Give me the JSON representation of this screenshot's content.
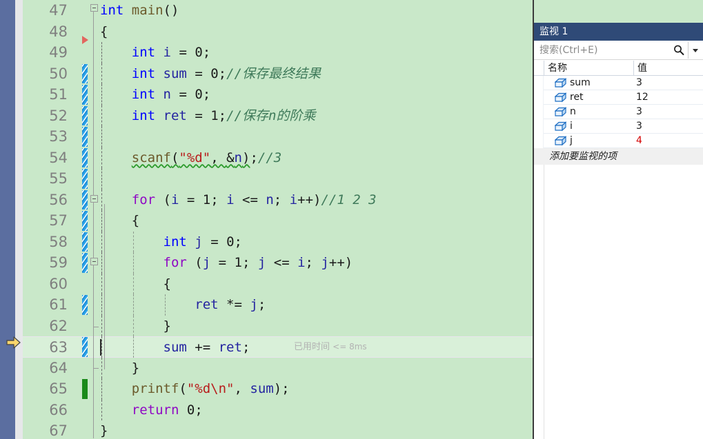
{
  "editor": {
    "background_color": "#c9e8c9",
    "current_line_number": 63,
    "lines": [
      {
        "no": "47",
        "segments": [
          {
            "t": "int",
            "c": "kw"
          },
          {
            "t": " ",
            "c": "punc"
          },
          {
            "t": "main",
            "c": "fn"
          },
          {
            "t": "()",
            "c": "punc"
          }
        ],
        "indent": 0,
        "changebar": "none"
      },
      {
        "no": "48",
        "segments": [
          {
            "t": "{",
            "c": "punc"
          }
        ],
        "indent": 0,
        "changebar": "none"
      },
      {
        "no": "49",
        "segments": [
          {
            "t": "    ",
            "c": "punc"
          },
          {
            "t": "int",
            "c": "kw"
          },
          {
            "t": " ",
            "c": "punc"
          },
          {
            "t": "i",
            "c": "id"
          },
          {
            "t": " = ",
            "c": "punc"
          },
          {
            "t": "0",
            "c": "num"
          },
          {
            "t": ";",
            "c": "punc"
          }
        ],
        "indent": 1,
        "changebar": "none"
      },
      {
        "no": "50",
        "segments": [
          {
            "t": "    ",
            "c": "punc"
          },
          {
            "t": "int",
            "c": "kw"
          },
          {
            "t": " ",
            "c": "punc"
          },
          {
            "t": "sum",
            "c": "id"
          },
          {
            "t": " = ",
            "c": "punc"
          },
          {
            "t": "0",
            "c": "num"
          },
          {
            "t": ";",
            "c": "punc"
          },
          {
            "t": "//保存最终结果",
            "c": "cmt"
          }
        ],
        "indent": 1,
        "changebar": "blue"
      },
      {
        "no": "51",
        "segments": [
          {
            "t": "    ",
            "c": "punc"
          },
          {
            "t": "int",
            "c": "kw"
          },
          {
            "t": " ",
            "c": "punc"
          },
          {
            "t": "n",
            "c": "id"
          },
          {
            "t": " = ",
            "c": "punc"
          },
          {
            "t": "0",
            "c": "num"
          },
          {
            "t": ";",
            "c": "punc"
          }
        ],
        "indent": 1,
        "changebar": "blue"
      },
      {
        "no": "52",
        "segments": [
          {
            "t": "    ",
            "c": "punc"
          },
          {
            "t": "int",
            "c": "kw"
          },
          {
            "t": " ",
            "c": "punc"
          },
          {
            "t": "ret",
            "c": "id"
          },
          {
            "t": " = ",
            "c": "punc"
          },
          {
            "t": "1",
            "c": "num"
          },
          {
            "t": ";",
            "c": "punc"
          },
          {
            "t": "//保存n的阶乘",
            "c": "cmt"
          }
        ],
        "indent": 1,
        "changebar": "blue"
      },
      {
        "no": "53",
        "segments": [],
        "indent": 1,
        "changebar": "blue"
      },
      {
        "no": "54",
        "segments": [
          {
            "t": "    ",
            "c": "punc"
          },
          {
            "t": "scanf",
            "c": "fn squiggle"
          },
          {
            "t": "(",
            "c": "punc squiggle"
          },
          {
            "t": "\"%d\"",
            "c": "str squiggle"
          },
          {
            "t": ", ",
            "c": "punc squiggle"
          },
          {
            "t": "&",
            "c": "punc squiggle"
          },
          {
            "t": "n",
            "c": "id squiggle"
          },
          {
            "t": ")",
            "c": "punc squiggle"
          },
          {
            "t": ";",
            "c": "punc"
          },
          {
            "t": "//3",
            "c": "cmt"
          }
        ],
        "indent": 1,
        "changebar": "blue"
      },
      {
        "no": "55",
        "segments": [],
        "indent": 1,
        "changebar": "blue"
      },
      {
        "no": "56",
        "segments": [
          {
            "t": "    ",
            "c": "punc"
          },
          {
            "t": "for",
            "c": "ctl"
          },
          {
            "t": " (",
            "c": "punc"
          },
          {
            "t": "i",
            "c": "id"
          },
          {
            "t": " = ",
            "c": "punc"
          },
          {
            "t": "1",
            "c": "num"
          },
          {
            "t": "; ",
            "c": "punc"
          },
          {
            "t": "i",
            "c": "id"
          },
          {
            "t": " <= ",
            "c": "punc"
          },
          {
            "t": "n",
            "c": "id"
          },
          {
            "t": "; ",
            "c": "punc"
          },
          {
            "t": "i",
            "c": "id"
          },
          {
            "t": "++)",
            "c": "punc"
          },
          {
            "t": "//1 2 3",
            "c": "cmt"
          }
        ],
        "indent": 1,
        "changebar": "blue"
      },
      {
        "no": "57",
        "segments": [
          {
            "t": "    {",
            "c": "punc"
          }
        ],
        "indent": 1,
        "changebar": "blue"
      },
      {
        "no": "58",
        "segments": [
          {
            "t": "        ",
            "c": "punc"
          },
          {
            "t": "int",
            "c": "kw"
          },
          {
            "t": " ",
            "c": "punc"
          },
          {
            "t": "j",
            "c": "id"
          },
          {
            "t": " = ",
            "c": "punc"
          },
          {
            "t": "0",
            "c": "num"
          },
          {
            "t": ";",
            "c": "punc"
          }
        ],
        "indent": 2,
        "changebar": "blue"
      },
      {
        "no": "59",
        "segments": [
          {
            "t": "        ",
            "c": "punc"
          },
          {
            "t": "for",
            "c": "ctl"
          },
          {
            "t": " (",
            "c": "punc"
          },
          {
            "t": "j",
            "c": "id"
          },
          {
            "t": " = ",
            "c": "punc"
          },
          {
            "t": "1",
            "c": "num"
          },
          {
            "t": "; ",
            "c": "punc"
          },
          {
            "t": "j",
            "c": "id"
          },
          {
            "t": " <= ",
            "c": "punc"
          },
          {
            "t": "i",
            "c": "id"
          },
          {
            "t": "; ",
            "c": "punc"
          },
          {
            "t": "j",
            "c": "id"
          },
          {
            "t": "++)",
            "c": "punc"
          }
        ],
        "indent": 2,
        "changebar": "blue"
      },
      {
        "no": "60",
        "segments": [
          {
            "t": "        {",
            "c": "punc"
          }
        ],
        "indent": 2,
        "changebar": "none"
      },
      {
        "no": "61",
        "segments": [
          {
            "t": "            ",
            "c": "punc"
          },
          {
            "t": "ret",
            "c": "id"
          },
          {
            "t": " *= ",
            "c": "punc"
          },
          {
            "t": "j",
            "c": "id"
          },
          {
            "t": ";",
            "c": "punc"
          }
        ],
        "indent": 3,
        "changebar": "blue"
      },
      {
        "no": "62",
        "segments": [
          {
            "t": "        }",
            "c": "punc"
          }
        ],
        "indent": 2,
        "changebar": "none"
      },
      {
        "no": "63",
        "segments": [
          {
            "t": "        ",
            "c": "punc"
          },
          {
            "t": "sum",
            "c": "id"
          },
          {
            "t": " += ",
            "c": "punc"
          },
          {
            "t": "ret",
            "c": "id"
          },
          {
            "t": ";",
            "c": "punc"
          }
        ],
        "indent": 2,
        "changebar": "blue"
      },
      {
        "no": "64",
        "segments": [
          {
            "t": "    }",
            "c": "punc"
          }
        ],
        "indent": 1,
        "changebar": "none"
      },
      {
        "no": "65",
        "segments": [
          {
            "t": "    ",
            "c": "punc"
          },
          {
            "t": "printf",
            "c": "fn"
          },
          {
            "t": "(",
            "c": "punc"
          },
          {
            "t": "\"%d\\n\"",
            "c": "str"
          },
          {
            "t": ", ",
            "c": "punc"
          },
          {
            "t": "sum",
            "c": "id"
          },
          {
            "t": ");",
            "c": "punc"
          }
        ],
        "indent": 1,
        "changebar": "green"
      },
      {
        "no": "66",
        "segments": [
          {
            "t": "    ",
            "c": "punc"
          },
          {
            "t": "return",
            "c": "ctl"
          },
          {
            "t": " ",
            "c": "punc"
          },
          {
            "t": "0",
            "c": "num"
          },
          {
            "t": ";",
            "c": "punc"
          }
        ],
        "indent": 1,
        "changebar": "none"
      },
      {
        "no": "67",
        "segments": [
          {
            "t": "}",
            "c": "punc"
          }
        ],
        "indent": 0,
        "changebar": "none"
      }
    ],
    "inline_diagnostic": {
      "label": "已用时间",
      "value": "<= 8ms",
      "line_no": "63"
    }
  },
  "watch": {
    "title": "监视 1",
    "search_placeholder": "搜索(Ctrl+E)",
    "search_value": "",
    "columns": {
      "name": "名称",
      "value": "值"
    },
    "rows": [
      {
        "name": "sum",
        "value": "3",
        "changed": false
      },
      {
        "name": "ret",
        "value": "12",
        "changed": false
      },
      {
        "name": "n",
        "value": "3",
        "changed": false
      },
      {
        "name": "i",
        "value": "3",
        "changed": false
      },
      {
        "name": "j",
        "value": "4",
        "changed": true
      }
    ],
    "add_row_hint": "添加要监视的项",
    "accent_color": "#2f4a77",
    "changed_value_color": "#d40000"
  }
}
